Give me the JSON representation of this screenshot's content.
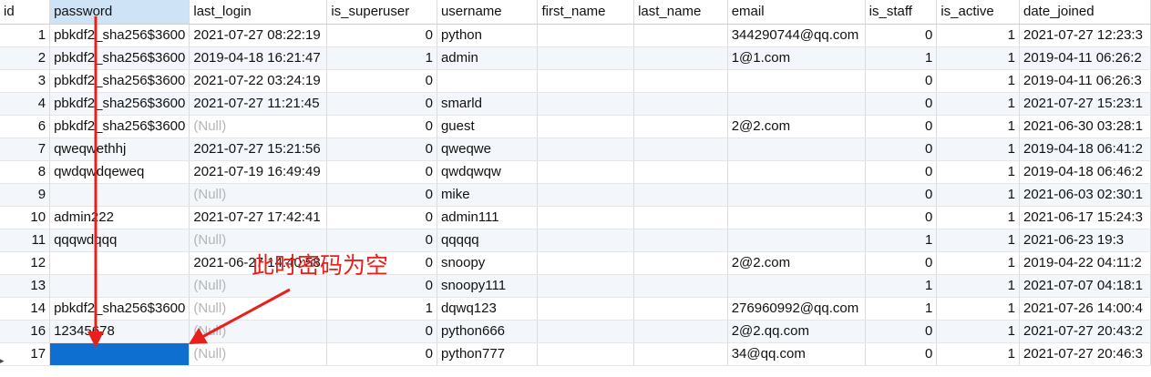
{
  "columns": [
    "id",
    "password",
    "last_login",
    "is_superuser",
    "username",
    "first_name",
    "last_name",
    "email",
    "is_staff",
    "is_active",
    "date_joined"
  ],
  "selected_column": "password",
  "rows": [
    {
      "id": "1",
      "password": "pbkdf2_sha256$3600",
      "last_login": "2021-07-27 08:22:19",
      "is_superuser": "0",
      "username": "python",
      "first_name": "",
      "last_name": "",
      "email": "344290744@qq.com",
      "is_staff": "0",
      "is_active": "1",
      "date_joined": "2021-07-27 12:23:3"
    },
    {
      "id": "2",
      "password": "pbkdf2_sha256$3600",
      "last_login": "2019-04-18 16:21:47",
      "is_superuser": "1",
      "username": "admin",
      "first_name": "",
      "last_name": "",
      "email": "1@1.com",
      "is_staff": "1",
      "is_active": "1",
      "date_joined": "2019-04-11 06:26:2"
    },
    {
      "id": "3",
      "password": "pbkdf2_sha256$3600",
      "last_login": "2021-07-22 03:24:19",
      "is_superuser": "0",
      "username": "",
      "first_name": "",
      "last_name": "",
      "email": "",
      "is_staff": "0",
      "is_active": "1",
      "date_joined": "2019-04-11 06:26:3"
    },
    {
      "id": "4",
      "password": "pbkdf2_sha256$3600",
      "last_login": "2021-07-27 11:21:45",
      "is_superuser": "0",
      "username": "smarld",
      "first_name": "",
      "last_name": "",
      "email": "",
      "is_staff": "0",
      "is_active": "1",
      "date_joined": "2021-07-27 15:23:1"
    },
    {
      "id": "6",
      "password": "pbkdf2_sha256$3600",
      "last_login": "(Null)",
      "is_superuser": "0",
      "username": "guest",
      "first_name": "",
      "last_name": "",
      "email": "2@2.com",
      "is_staff": "0",
      "is_active": "1",
      "date_joined": "2021-06-30 03:28:1"
    },
    {
      "id": "7",
      "password": "qweqwethhj",
      "last_login": "2021-07-27 15:21:56",
      "is_superuser": "0",
      "username": "qweqwe",
      "first_name": "",
      "last_name": "",
      "email": "",
      "is_staff": "0",
      "is_active": "1",
      "date_joined": "2019-04-18 06:41:2"
    },
    {
      "id": "8",
      "password": "qwdqwdqeweq",
      "last_login": "2021-07-19 16:49:49",
      "is_superuser": "0",
      "username": "qwdqwqw",
      "first_name": "",
      "last_name": "",
      "email": "",
      "is_staff": "0",
      "is_active": "1",
      "date_joined": "2019-04-18 06:46:2"
    },
    {
      "id": "9",
      "password": "",
      "last_login": "(Null)",
      "is_superuser": "0",
      "username": "mike",
      "first_name": "",
      "last_name": "",
      "email": "",
      "is_staff": "0",
      "is_active": "1",
      "date_joined": "2021-06-03 02:30:1"
    },
    {
      "id": "10",
      "password": "admin222",
      "last_login": "2021-07-27 17:42:41",
      "is_superuser": "0",
      "username": "admin111",
      "first_name": "",
      "last_name": "",
      "email": "",
      "is_staff": "0",
      "is_active": "1",
      "date_joined": "2021-06-17 15:24:3"
    },
    {
      "id": "11",
      "password": "qqqwdqqq",
      "last_login": "(Null)",
      "is_superuser": "0",
      "username": "qqqqq",
      "first_name": "",
      "last_name": "",
      "email": "",
      "is_staff": "1",
      "is_active": "1",
      "date_joined": "2021-06-23 19:3"
    },
    {
      "id": "12",
      "password": "",
      "last_login": "2021-06-27 14:40:58",
      "is_superuser": "0",
      "username": "snoopy",
      "first_name": "",
      "last_name": "",
      "email": "2@2.com",
      "is_staff": "0",
      "is_active": "1",
      "date_joined": "2019-04-22 04:11:2"
    },
    {
      "id": "13",
      "password": "",
      "last_login": "(Null)",
      "is_superuser": "0",
      "username": "snoopy111",
      "first_name": "",
      "last_name": "",
      "email": "",
      "is_staff": "1",
      "is_active": "1",
      "date_joined": "2021-07-07 04:18:1"
    },
    {
      "id": "14",
      "password": "pbkdf2_sha256$3600",
      "last_login": "(Null)",
      "is_superuser": "1",
      "username": "dqwq123",
      "first_name": "",
      "last_name": "",
      "email": "276960992@qq.com",
      "is_staff": "1",
      "is_active": "1",
      "date_joined": "2021-07-26 14:00:4"
    },
    {
      "id": "16",
      "password": "12345678",
      "last_login": "(Null)",
      "is_superuser": "0",
      "username": "python666",
      "first_name": "",
      "last_name": "",
      "email": "2@2.qq.com",
      "is_staff": "0",
      "is_active": "1",
      "date_joined": "2021-07-27 20:43:2"
    },
    {
      "id": "17",
      "password": "",
      "last_login": "(Null)",
      "is_superuser": "0",
      "username": "python777",
      "first_name": "",
      "last_name": "",
      "email": "34@qq.com",
      "is_staff": "0",
      "is_active": "1",
      "date_joined": "2021-07-27 20:46:3"
    }
  ],
  "current_row_marker": "▸",
  "annotation": {
    "text": "此时密码为空",
    "color": "#e8201c"
  },
  "colors": {
    "selected_header": "#cfe3f7",
    "selected_cell": "#0f6fd1",
    "alt_row": "#f3f6fa",
    "null_text": "#b5b5b5"
  }
}
